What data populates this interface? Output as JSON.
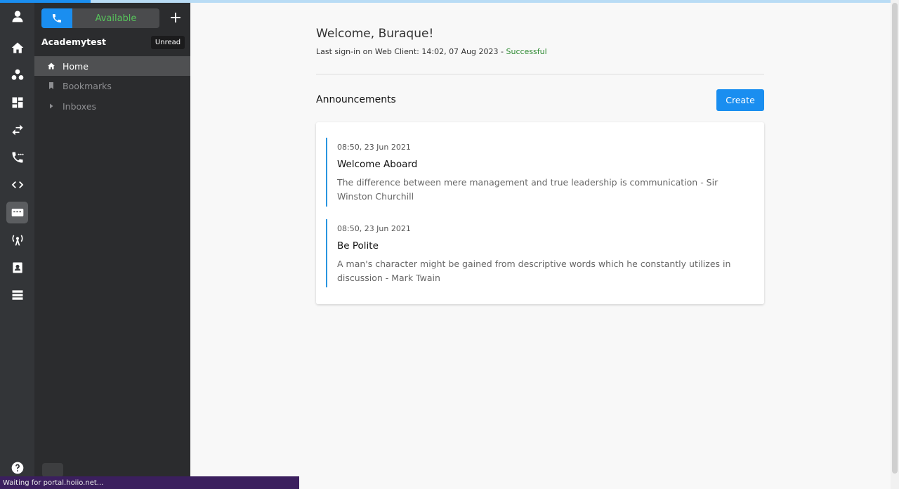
{
  "top_progress": {
    "fraction": 0.102
  },
  "rail": {
    "icons": [
      "user-icon",
      "home-icon",
      "groups-icon",
      "dashboard-icon",
      "transfer-icon",
      "phone-dots-icon",
      "code-icon",
      "sms-icon",
      "broadcast-icon",
      "contacts-icon",
      "list-icon",
      "help-icon"
    ]
  },
  "sidebar": {
    "status": "Available",
    "plus": "+",
    "org_name": "Academytest",
    "unread_label": "Unread",
    "nav": [
      {
        "label": "Home",
        "icon": "home-icon",
        "active": true
      },
      {
        "label": "Bookmarks",
        "icon": "bookmark-icon",
        "active": false
      },
      {
        "label": "Inboxes",
        "icon": "caret-right-icon",
        "active": false
      }
    ]
  },
  "main": {
    "welcome": "Welcome, Buraque!",
    "last_signin_prefix": "Last sign-in on Web Client: 14:02, 07 Aug 2023 - ",
    "last_signin_status": "Successful",
    "announcements_title": "Announcements",
    "create_label": "Create",
    "announcements": [
      {
        "date": "08:50, 23 Jun 2021",
        "title": "Welcome Aboard",
        "body": "The difference between mere management and true leadership is communication - Sir Winston Churchill"
      },
      {
        "date": "08:50, 23 Jun 2021",
        "title": "Be Polite",
        "body": "A man's character might be gained from descriptive words which he constantly utilizes in discussion - Mark Twain"
      }
    ]
  },
  "status_bar": {
    "text": "Waiting for portal.hoiio.net..."
  },
  "colors": {
    "accent": "#1a8ef0",
    "success": "#2e8a32",
    "available": "#57c45b",
    "rail_bg": "#333538",
    "sidebar_bg": "#2b2c2e"
  }
}
